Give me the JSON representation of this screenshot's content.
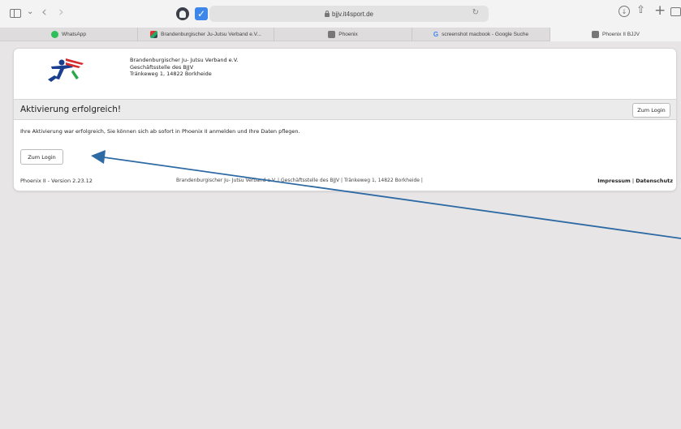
{
  "browser": {
    "url": "bjjv.it4sport.de",
    "tabs": [
      {
        "label": "WhatsApp",
        "favicon": "whatsapp-icon"
      },
      {
        "label": "Brandenburgischer Ju-Jutsu Verband e.V...",
        "favicon": "bjjv-icon"
      },
      {
        "label": "Phoenix",
        "favicon": "phoenix-icon"
      },
      {
        "label": "screenshot macbook - Google Suche",
        "favicon": "google-icon"
      },
      {
        "label": "Phoenix II BJJV",
        "favicon": "phoenix-icon"
      }
    ]
  },
  "org": {
    "name": "Brandenburgischer Ju- Jutsu Verband e.V.",
    "office": "Geschäftsstelle des BJJV",
    "address": "Tränkeweg 1, 14822 Borkheide"
  },
  "page": {
    "title": "Aktivierung erfolgreich!",
    "login_top": "Zum Login",
    "message": "Ihre Aktivierung war erfolgreich, Sie können sich ab sofort in Phoenix II anmelden und Ihre Daten pflegen.",
    "login_button": "Zum Login"
  },
  "footer": {
    "version": "Phoenix II - Version 2.23.12",
    "center": "Brandenburgischer Ju- Jutsu Verband e.V. | Geschäftsstelle des BJJV | Tränkeweg 1, 14822 Borkheide |",
    "impressum": "Impressum",
    "separator": "|",
    "datenschutz": "Datenschutz"
  },
  "colors": {
    "arrow": "#2e6aa3",
    "logo_blue": "#1a3f8f",
    "logo_red": "#d62b2b",
    "logo_green": "#2aa84a"
  }
}
